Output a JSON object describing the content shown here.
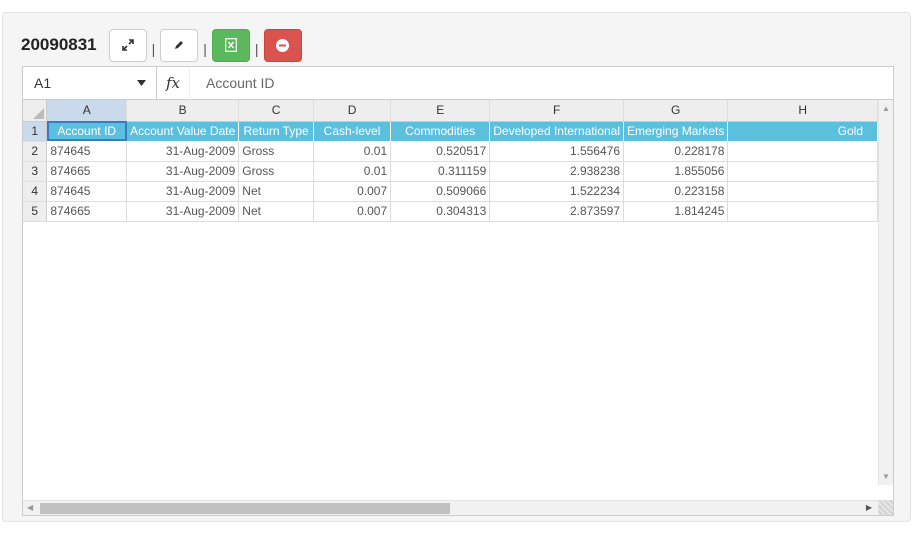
{
  "doc_title": "20090831",
  "toolbar": {
    "separator": "|",
    "buttons": [
      {
        "name": "expand-button",
        "icon": "expand-icon"
      },
      {
        "name": "edit-button",
        "icon": "pencil-icon"
      },
      {
        "name": "export-excel-button",
        "icon": "excel-icon",
        "color": "#5cb85c"
      },
      {
        "name": "remove-button",
        "icon": "minus-circle-icon",
        "color": "#d9534f"
      }
    ]
  },
  "formula_bar": {
    "cell_ref": "A1",
    "fx_label": "fx",
    "formula": "Account ID"
  },
  "colors": {
    "header_fill": "#5bc0de",
    "header_text": "#ffffff",
    "active_heading": "#c9daea"
  },
  "sheet": {
    "columns": [
      "A",
      "B",
      "C",
      "D",
      "E",
      "F",
      "G",
      "H"
    ],
    "row_numbers": [
      "1",
      "2",
      "3",
      "4",
      "5"
    ],
    "header_row": [
      "Account ID",
      "Account Value Date",
      "Return Type",
      "Cash-level",
      "Commodities",
      "Developed International",
      "Emerging Markets",
      "Gold"
    ],
    "rows": [
      [
        "874645",
        "31-Aug-2009",
        "Gross",
        "0.01",
        "0.520517",
        "1.556476",
        "0.228178",
        ""
      ],
      [
        "874665",
        "31-Aug-2009",
        "Gross",
        "0.01",
        "0.311159",
        "2.938238",
        "1.855056",
        ""
      ],
      [
        "874645",
        "31-Aug-2009",
        "Net",
        "0.007",
        "0.509066",
        "1.522234",
        "0.223158",
        ""
      ],
      [
        "874665",
        "31-Aug-2009",
        "Net",
        "0.007",
        "0.304313",
        "2.873597",
        "1.814245",
        ""
      ]
    ],
    "empty_rows": 13
  }
}
